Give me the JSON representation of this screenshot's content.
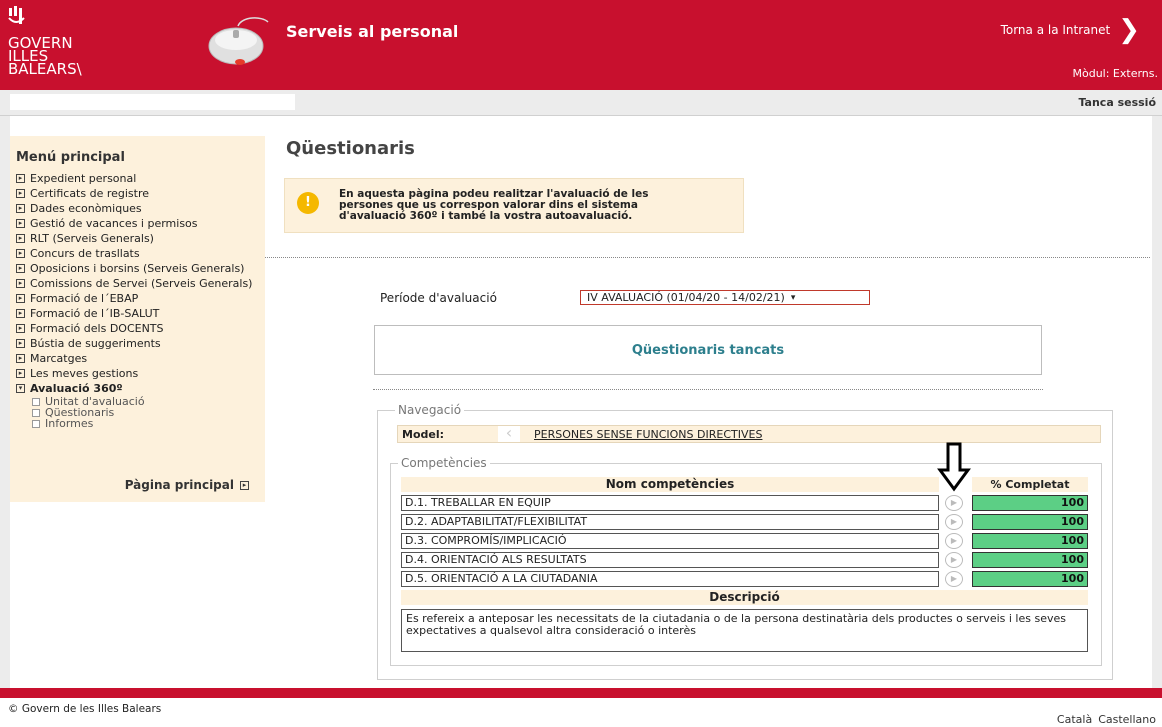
{
  "header": {
    "logo_line1": "GOVERN",
    "logo_line2": "ILLES",
    "logo_line3": "BALEARS\\",
    "app_title": "Serveis al personal",
    "back_link": "Torna a la Intranet",
    "module": "Mòdul: Externs."
  },
  "subbar": {
    "logout": "Tanca sessió"
  },
  "sidebar": {
    "title": "Menú principal",
    "items": [
      {
        "label": "Expedient personal"
      },
      {
        "label": "Certificats de registre"
      },
      {
        "label": "Dades econòmiques"
      },
      {
        "label": "Gestió de vacances i permisos"
      },
      {
        "label": "RLT (Serveis Generals)"
      },
      {
        "label": "Concurs de trasllats"
      },
      {
        "label": "Oposicions i borsins (Serveis Generals)"
      },
      {
        "label": "Comissions de Servei (Serveis Generals)"
      },
      {
        "label": "Formació de l´EBAP"
      },
      {
        "label": "Formació de l´IB-SALUT"
      },
      {
        "label": "Formació dels DOCENTS"
      },
      {
        "label": "Bústia de suggeriments"
      },
      {
        "label": "Marcatges"
      },
      {
        "label": "Les meves gestions"
      },
      {
        "label": "Avaluació 360º"
      }
    ],
    "subitems": [
      {
        "label": "Unitat d'avaluació"
      },
      {
        "label": "Qüestionaris"
      },
      {
        "label": "Informes"
      }
    ],
    "home_link": "Pàgina principal"
  },
  "main": {
    "title": "Qüestionaris",
    "info_line1": "En aquesta pàgina podeu realitzar l'avaluació de les",
    "info_line2": "persones que us correspon valorar dins el sistema",
    "info_line3": "d'avaluació 360º i també la vostra autoavaluació.",
    "period_label": "Període d'avaluació",
    "period_value": "IV AVALUACIÓ (01/04/20 - 14/02/21)",
    "closed_title": "Qüestionaris tancats",
    "nav_legend": "Navegació",
    "model_label": "Model:",
    "model_value": "PERSONES SENSE FUNCIONS DIRECTIVES",
    "comp_legend": "Competències",
    "col_name": "Nom competències",
    "col_pct": "% Completat",
    "competencies": [
      {
        "name": "D.1. TREBALLAR EN EQUIP",
        "pct": "100"
      },
      {
        "name": "D.2. ADAPTABILITAT/FLEXIBILITAT",
        "pct": "100"
      },
      {
        "name": "D.3. COMPROMÍS/IMPLICACIÓ",
        "pct": "100"
      },
      {
        "name": "D.4. ORIENTACIÓ ALS RESULTATS",
        "pct": "100"
      },
      {
        "name": "D.5. ORIENTACIÓ A LA CIUTADANIA",
        "pct": "100"
      }
    ],
    "desc_header": "Descripció",
    "description": "Es refereix a anteposar les necessitats de la ciutadania o de la persona destinatària dels productes o serveis i les seves expectatives a qualsevol altra consideració o interès"
  },
  "footer": {
    "copyright": "© Govern de les Illes Balears",
    "lang_ca": "Català",
    "lang_es": "Castellano"
  },
  "colors": {
    "brand_red": "#c8102e",
    "complete_green": "#5ccf85",
    "beige": "#fdf1dc",
    "teal": "#2d7f8d"
  },
  "icons": [
    "logo-mark-icon",
    "mouse-icon",
    "chevron-right-icon",
    "expand-box-icon",
    "info-icon",
    "select-caret-icon",
    "chevron-left-icon",
    "play-icon",
    "arrow-down-icon"
  ]
}
